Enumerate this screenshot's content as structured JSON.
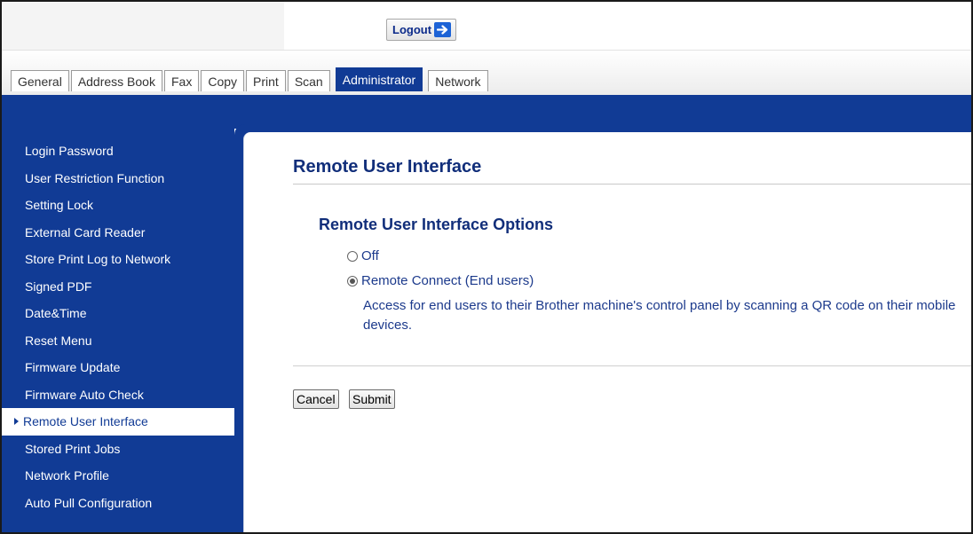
{
  "header": {
    "logout_label": "Logout"
  },
  "tabs": [
    {
      "label": "General",
      "active": false
    },
    {
      "label": "Address Book",
      "active": false
    },
    {
      "label": "Fax",
      "active": false
    },
    {
      "label": "Copy",
      "active": false
    },
    {
      "label": "Print",
      "active": false
    },
    {
      "label": "Scan",
      "active": false
    },
    {
      "label": "Administrator",
      "active": true
    },
    {
      "label": "Network",
      "active": false
    }
  ],
  "sidebar": {
    "items": [
      {
        "label": "Login Password"
      },
      {
        "label": "User Restriction Function"
      },
      {
        "label": "Setting Lock"
      },
      {
        "label": "External Card Reader"
      },
      {
        "label": "Store Print Log to Network"
      },
      {
        "label": "Signed PDF"
      },
      {
        "label": "Date&Time"
      },
      {
        "label": "Reset Menu"
      },
      {
        "label": "Firmware Update"
      },
      {
        "label": "Firmware Auto Check"
      },
      {
        "label": "Remote User Interface",
        "active": true
      },
      {
        "label": "Stored Print Jobs"
      },
      {
        "label": "Network Profile"
      },
      {
        "label": "Auto Pull Configuration"
      }
    ]
  },
  "main": {
    "title": "Remote User Interface",
    "section_title": "Remote User Interface Options",
    "options": [
      {
        "label": "Off",
        "checked": false
      },
      {
        "label": "Remote Connect (End users)",
        "checked": true
      }
    ],
    "description": "Access for end users to their Brother machine's control panel by scanning a QR code on their mobile devices.",
    "cancel_label": "Cancel",
    "submit_label": "Submit"
  },
  "colors": {
    "brand_blue": "#113b95",
    "title_blue": "#112e7a",
    "logout_arrow": "#1d63d6"
  },
  "icons": {
    "logout": "arrow-right-icon",
    "active_menu": "triangle-right-icon"
  }
}
